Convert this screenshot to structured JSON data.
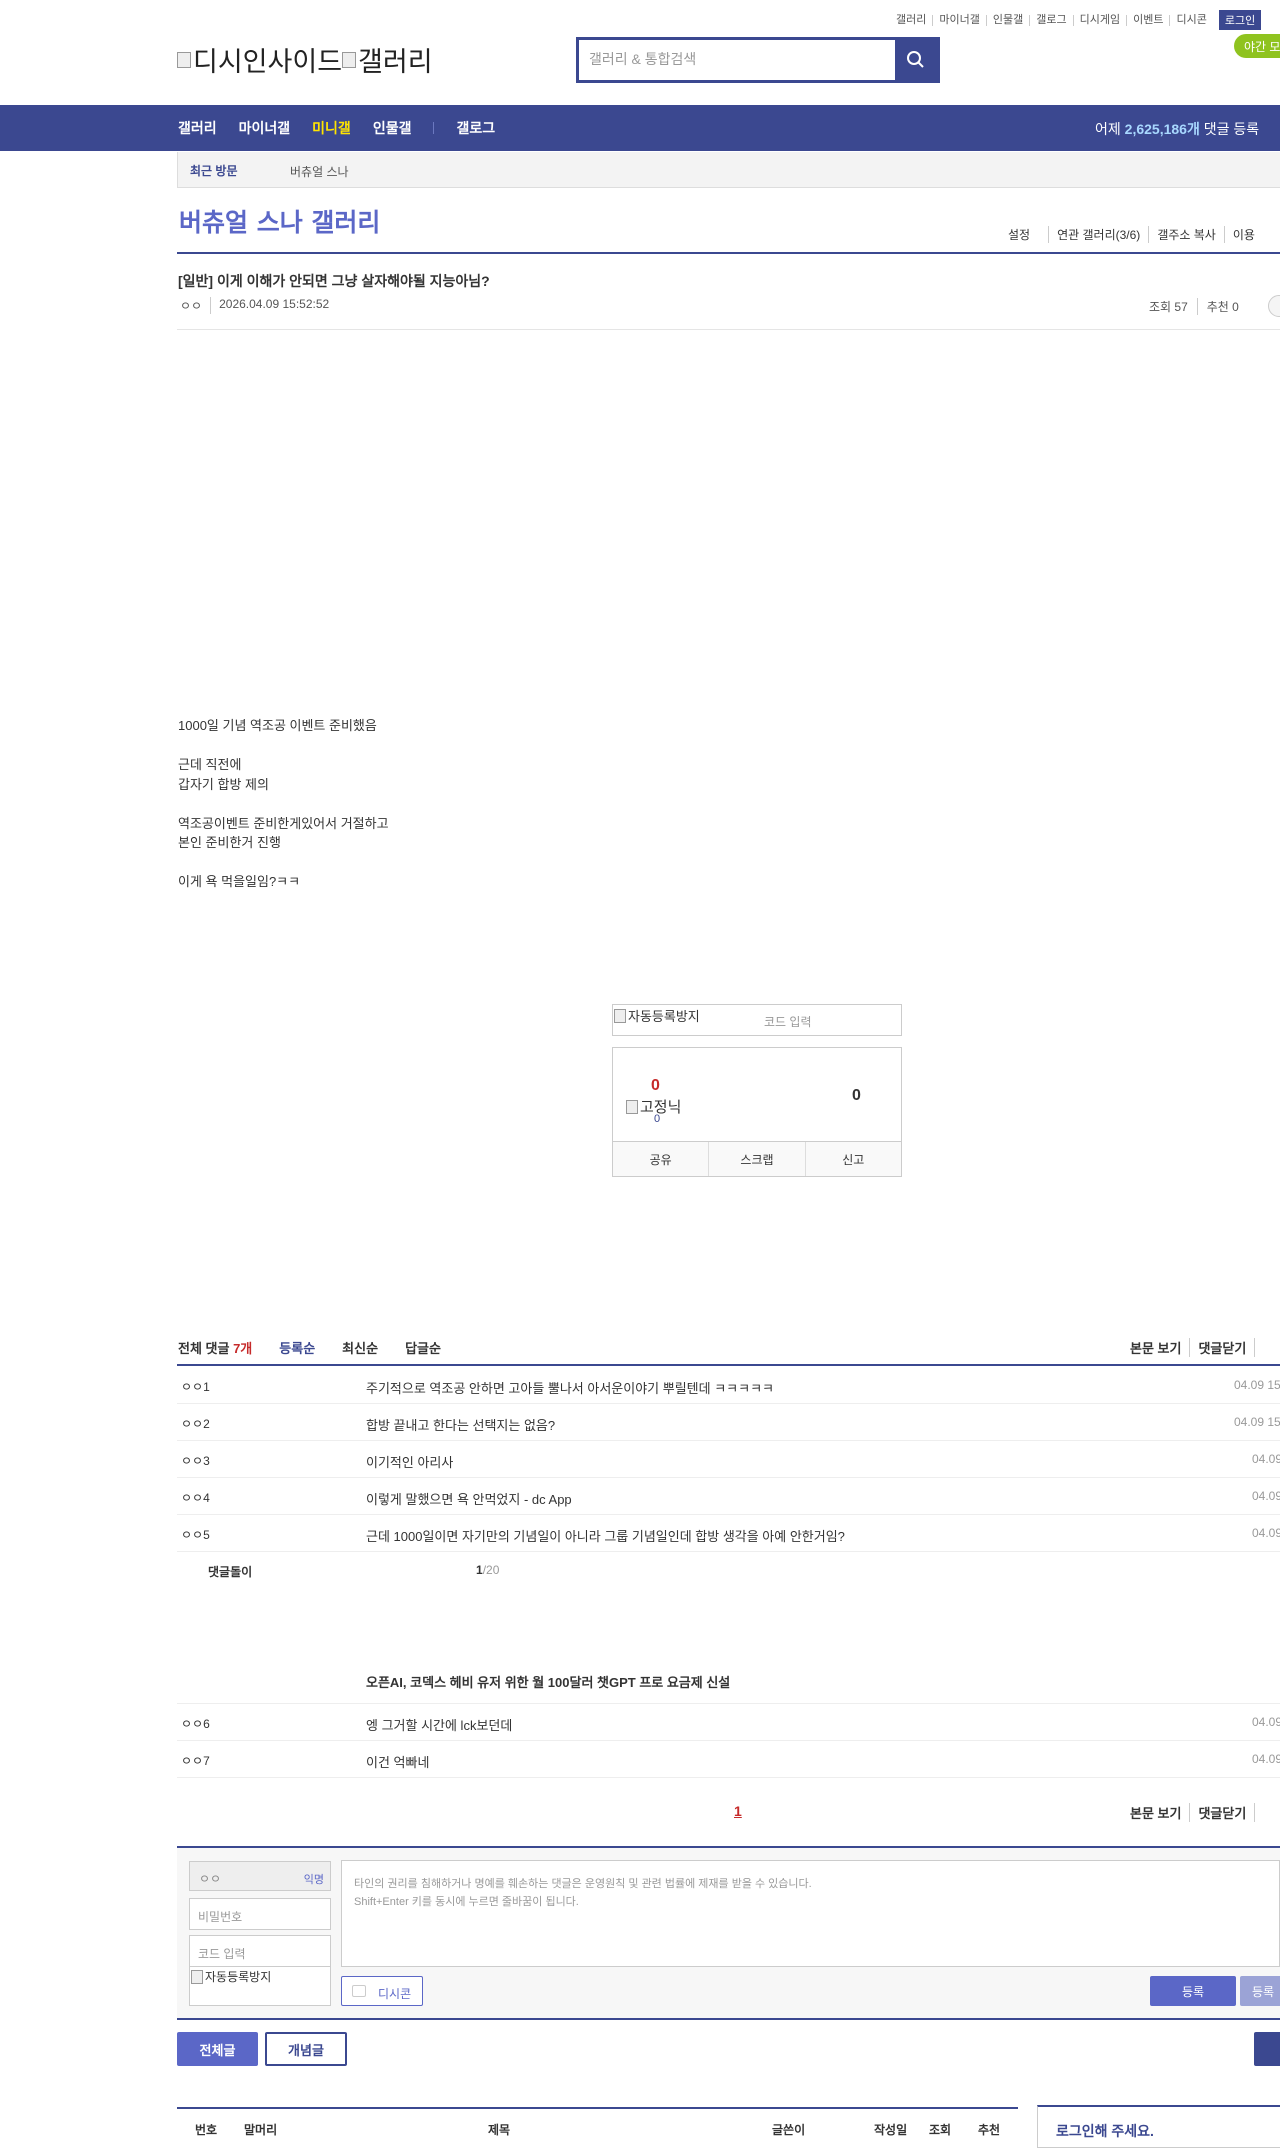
{
  "top_util": [
    "갤러리",
    "마이너갤",
    "인물갤",
    "갤로그",
    "디시게임",
    "이벤트",
    "디시콘"
  ],
  "login_label": "로그인",
  "night_mode": "야간 모드",
  "logo": {
    "alt1": "디시인사이드",
    "alt2": "갤러리"
  },
  "search": {
    "placeholder": "갤러리 & 통합검색"
  },
  "gnb": {
    "items": [
      "갤러리",
      "마이너갤",
      "미니갤",
      "인물갤",
      "갤로그"
    ],
    "active": "미니갤",
    "yesterday_label": "어제",
    "yesterday_count": "2,625,186개",
    "yesterday_suffix": "댓글 등록"
  },
  "recent": {
    "label": "최근 방문",
    "items": [
      "버츄얼 스나"
    ]
  },
  "gallery": {
    "title": "버츄얼 스나 갤러리",
    "links": [
      "설정",
      "연관 갤러리(3/6)",
      "갤주소 복사",
      "이용"
    ]
  },
  "post": {
    "title": "[일반] 이게 이해가 안되면 그냥 살자해야될 지능아님?",
    "author": "ㅇㅇ",
    "date": "2026.04.09 15:52:52",
    "views": "조회 57",
    "recommend": "추천 0",
    "body": [
      "1000일 기념 역조공 이벤트 준비했음",
      "",
      "근데 직전에",
      "갑자기 합방 제의",
      "",
      "역조공이벤트 준비한게있어서 거절하고",
      "본인 준비한거 진행",
      "",
      "이게 욕 먹을일임?ㅋㅋ"
    ]
  },
  "captcha": {
    "alt": "자동등록방지",
    "placeholder": "코드 입력"
  },
  "recommend_box": {
    "up": "0",
    "fixed_alt": "고정닉",
    "fixed_count": "0",
    "down": "0",
    "buttons": [
      "공유",
      "스크랩",
      "신고"
    ]
  },
  "comments": {
    "total_label": "전체 댓글",
    "total_count": "7개",
    "sorts": [
      "등록순",
      "최신순",
      "답글순"
    ],
    "right_links": [
      "본문 보기",
      "댓글닫기"
    ],
    "rows": [
      {
        "nick": "ㅇㅇ1",
        "text": "주기적으로 역조공 안하면 고아들 뿔나서 아서운이야기 뿌릴텐데 ㅋㅋㅋㅋㅋ",
        "date": "04.09 15"
      },
      {
        "nick": "ㅇㅇ2",
        "text": "합방 끝내고 한다는 선택지는 없음?",
        "date": "04.09 15"
      },
      {
        "nick": "ㅇㅇ3",
        "text": "이기적인 아리사",
        "date": "04.09"
      },
      {
        "nick": "ㅇㅇ4",
        "text": "이렇게 말했으면 욕 안먹었지 - dc App",
        "date": "04.09"
      },
      {
        "nick": "ㅇㅇ5",
        "text": "근데 1000일이면 자기만의 기념일이 아니라 그룹 기념일인데 합방 생각을 아예 안한거임?",
        "date": "04.09"
      }
    ],
    "bot_label": "댓글돌이",
    "bot_page_current": "1",
    "bot_page_total": "/20",
    "news_title": "오픈AI, 코덱스 헤비 유저 위한 월 100달러 챗GPT 프로 요금제 신설",
    "rows2": [
      {
        "nick": "ㅇㅇ6",
        "text": "엥 그거할 시간에 lck보던데",
        "date": "04.09"
      },
      {
        "nick": "ㅇㅇ7",
        "text": "이건 억빠네",
        "date": "04.09"
      }
    ],
    "page": "1"
  },
  "write_form": {
    "nick": "ㅇㅇ",
    "nick_tag": "익명",
    "pw_placeholder": "비밀번호",
    "code_placeholder": "코드 입력",
    "captcha_alt": "자동등록방지",
    "textarea_line1": "타인의 권리를 침해하거나 명예를 훼손하는 댓글은 운영원칙 및 관련 법률에 제재를 받을 수 있습니다.",
    "textarea_line2": "Shift+Enter 키를 동시에 누르면 줄바꿈이 됩니다.",
    "dccon": "디시콘",
    "submit": "등록",
    "submit2": "등록"
  },
  "list_tabs": {
    "all": "전체글",
    "concept": "개념글"
  },
  "list_head": [
    "번호",
    "말머리",
    "제목",
    "글쓴이",
    "작성일",
    "조회",
    "추천"
  ],
  "login_panel": "로그인해 주세요.",
  "colors": {
    "brand": "#3b4890",
    "accent": "#5b67c7",
    "highlight": "#ffe400",
    "alert": "#c62a2a",
    "night": "#8fc31f"
  }
}
